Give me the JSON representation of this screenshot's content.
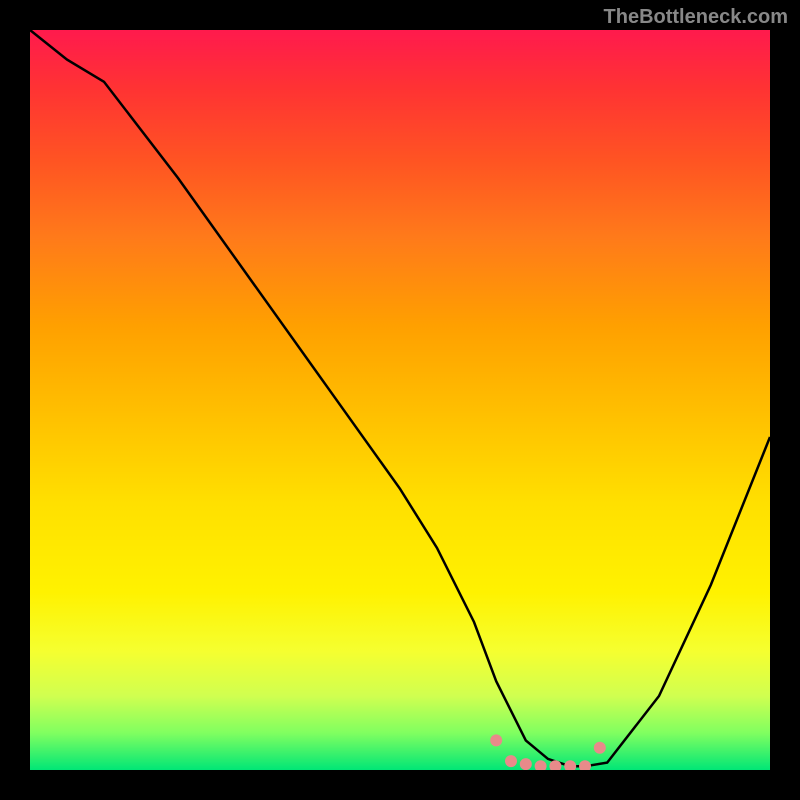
{
  "watermark": "TheBottleneck.com",
  "chart_data": {
    "type": "line",
    "title": "",
    "xlabel": "",
    "ylabel": "",
    "xlim": [
      0,
      100
    ],
    "ylim": [
      0,
      100
    ],
    "series": [
      {
        "name": "bottleneck-curve",
        "x": [
          0,
          5,
          10,
          20,
          30,
          40,
          50,
          55,
          60,
          63,
          65,
          67,
          70,
          73,
          75,
          78,
          85,
          92,
          100
        ],
        "y": [
          100,
          96,
          93,
          80,
          66,
          52,
          38,
          30,
          20,
          12,
          8,
          4,
          1.5,
          0.5,
          0.5,
          1,
          10,
          25,
          45
        ]
      }
    ],
    "markers": [
      {
        "name": "left-dot",
        "x": 63,
        "y": 4,
        "color": "#e88a8a"
      },
      {
        "name": "bottom-1",
        "x": 65,
        "y": 1.2,
        "color": "#e88a8a"
      },
      {
        "name": "bottom-2",
        "x": 67,
        "y": 0.8,
        "color": "#e88a8a"
      },
      {
        "name": "bottom-3",
        "x": 69,
        "y": 0.5,
        "color": "#e88a8a"
      },
      {
        "name": "bottom-4",
        "x": 71,
        "y": 0.5,
        "color": "#e88a8a"
      },
      {
        "name": "bottom-5",
        "x": 73,
        "y": 0.5,
        "color": "#e88a8a"
      },
      {
        "name": "bottom-6",
        "x": 75,
        "y": 0.5,
        "color": "#e88a8a"
      },
      {
        "name": "right-dot",
        "x": 77,
        "y": 3,
        "color": "#e88a8a"
      }
    ]
  }
}
